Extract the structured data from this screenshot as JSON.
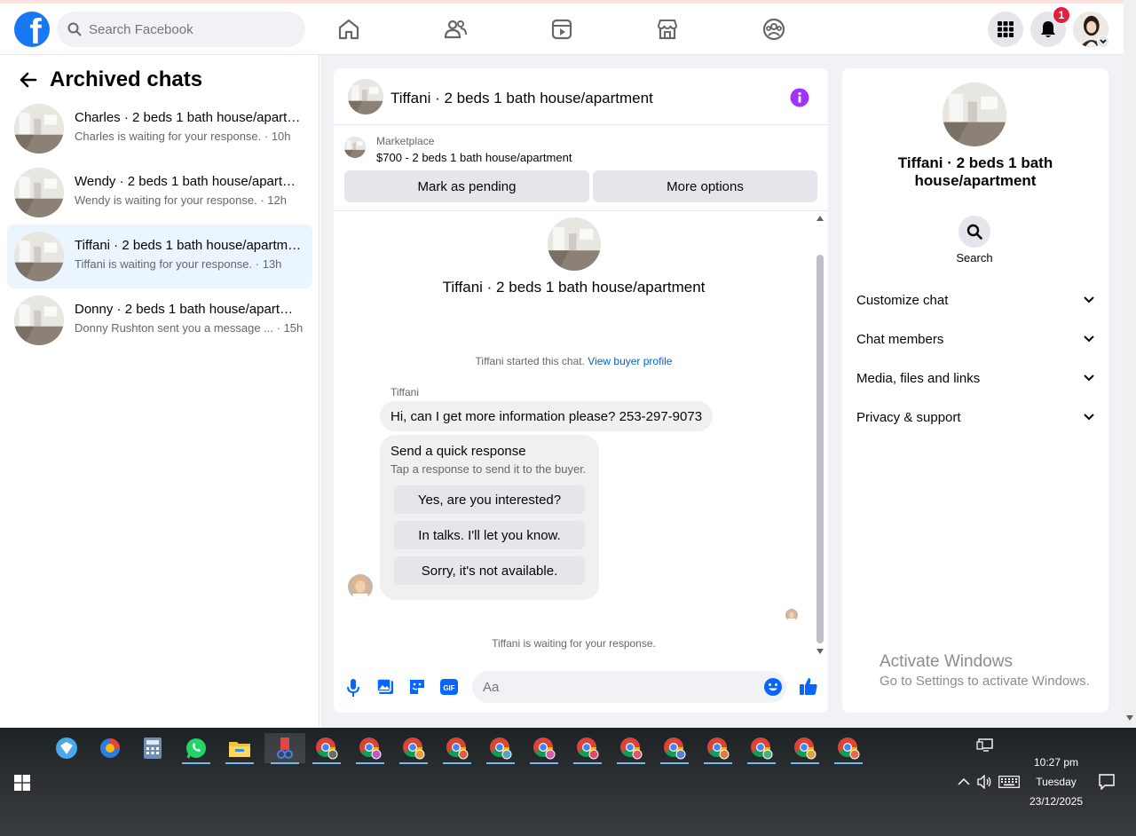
{
  "topbar": {
    "logo_letter": "f",
    "search_placeholder": "Search Facebook",
    "notification_count": "1",
    "nav_icons": [
      "home-icon",
      "friends-icon",
      "video-icon",
      "marketplace-icon",
      "groups-icon"
    ]
  },
  "left": {
    "title": "Archived chats",
    "chats": [
      {
        "name": "Charles · 2 beds 1 bath house/apartment",
        "preview": "Charles is waiting for your response.",
        "time": "10h"
      },
      {
        "name": "Wendy · 2 beds 1 bath house/apartment",
        "preview": "Wendy is waiting for your response.",
        "time": "12h"
      },
      {
        "name": "Tiffani · 2 beds 1 bath house/apartment",
        "preview": "Tiffani is waiting for your response.",
        "time": "13h"
      },
      {
        "name": "Donny · 2 beds 1 bath house/apartment",
        "preview": "Donny Rushton sent you a message ...",
        "time": "15h"
      }
    ]
  },
  "conversation": {
    "title": "Tiffani · 2 beds 1 bath house/apartment",
    "listing": {
      "source": "Marketplace",
      "title": "$700 - 2 beds 1 bath house/apartment",
      "mark_pending": "Mark as pending",
      "more_options": "More options"
    },
    "intro_title": "Tiffani · 2 beds 1 bath house/apartment",
    "started_text": "Tiffani started this chat.",
    "buyer_profile_link": "View buyer profile",
    "sender": "Tiffani",
    "message": "Hi, can I get more information please? 253-297-9073",
    "quick": {
      "title": "Send a quick response",
      "subtitle": "Tap a response to send it to the buyer.",
      "options": [
        "Yes, are you interested?",
        "In talks. I'll let you know.",
        "Sorry, it's not available."
      ]
    },
    "waiting_text": "Tiffani is waiting for your response.",
    "composer_placeholder": "Aa",
    "gif_label": "GIF"
  },
  "info": {
    "name": "Tiffani · 2 beds 1 bath house/apartment",
    "search_label": "Search",
    "sections": [
      "Customize chat",
      "Chat members",
      "Media, files and links",
      "Privacy & support"
    ]
  },
  "watermark": {
    "line1": "Activate Windows",
    "line2": "Go to Settings to activate Windows."
  },
  "taskbar": {
    "time": "10:27 pm",
    "day": "Tuesday",
    "date": "23/12/2025"
  },
  "colors": {
    "brand": "#1877f2",
    "badge": "#e41e3f",
    "info_icon": "#a033ff",
    "active_chat": "#ebf5ff",
    "link": "#0064d1"
  }
}
